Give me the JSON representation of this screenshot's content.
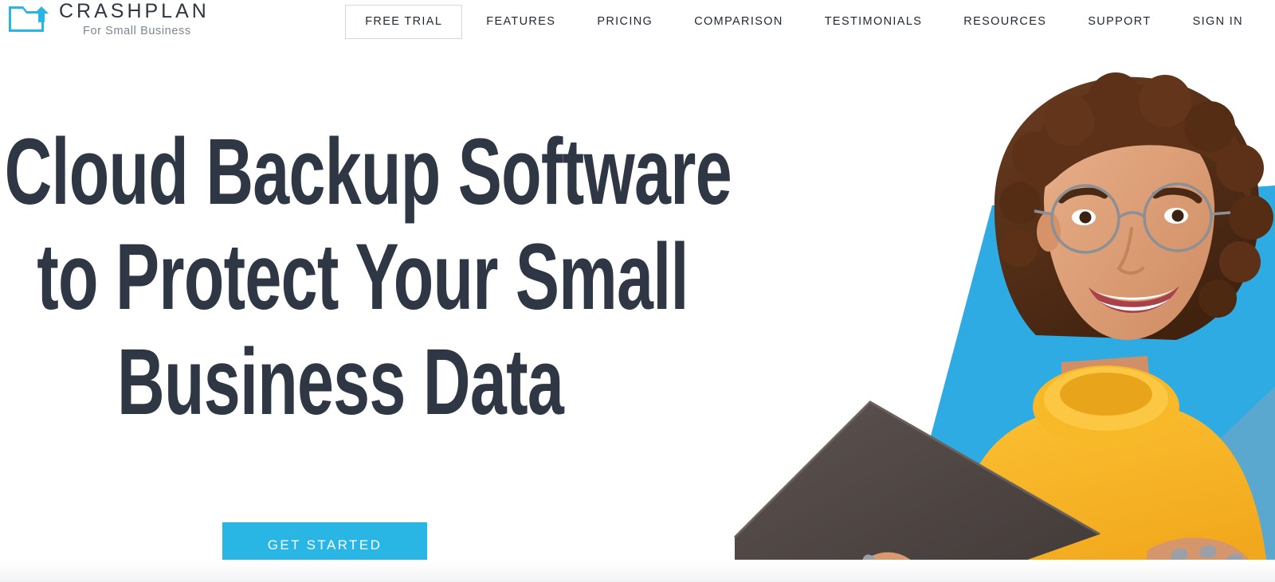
{
  "brand": {
    "name": "CRASHPLAN",
    "tagline": "For Small Business",
    "logo_icon": "folder-upload-icon",
    "accent_color": "#29b6e5",
    "dark_color": "#2f3744"
  },
  "nav": {
    "items": [
      {
        "label": "FREE TRIAL",
        "boxed": true,
        "name": "nav-free-trial"
      },
      {
        "label": "FEATURES",
        "boxed": false,
        "name": "nav-features"
      },
      {
        "label": "PRICING",
        "boxed": false,
        "name": "nav-pricing"
      },
      {
        "label": "COMPARISON",
        "boxed": false,
        "name": "nav-comparison"
      },
      {
        "label": "TESTIMONIALS",
        "boxed": false,
        "name": "nav-testimonials"
      },
      {
        "label": "RESOURCES",
        "boxed": false,
        "name": "nav-resources"
      },
      {
        "label": "SUPPORT",
        "boxed": false,
        "name": "nav-support"
      },
      {
        "label": "SIGN IN",
        "boxed": false,
        "name": "nav-sign-in"
      }
    ]
  },
  "hero": {
    "headline_line1": "Cloud Backup Software",
    "headline_line2": "to Protect Your Small",
    "headline_line3": "Business Data",
    "cta_label": "GET STARTED",
    "cta_color": "#29b6e5",
    "image_description": "smiling woman in yellow turtleneck sweater with glasses holding a laptop over cyan and blue angled shapes",
    "shape_cyan": "#2eabe2",
    "shape_blue": "#5aa7cf",
    "shape_gray": "#c3c8cf"
  }
}
